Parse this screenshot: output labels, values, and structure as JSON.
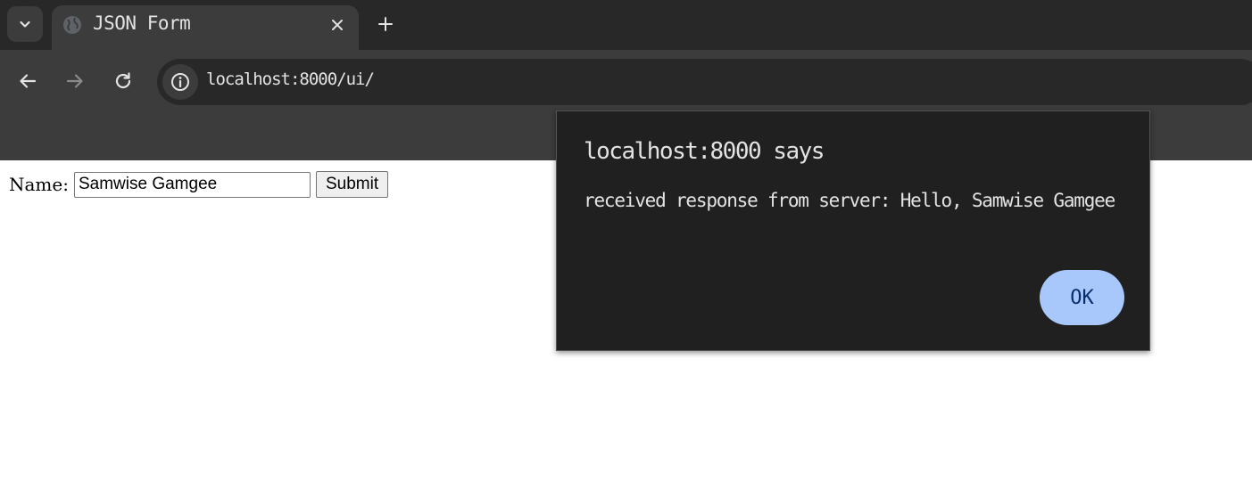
{
  "browser": {
    "tab": {
      "title": "JSON Form",
      "close_icon": "close-icon",
      "favicon_icon": "globe-icon"
    },
    "new_tab_icon": "plus-icon",
    "tab_search_icon": "chevron-down-icon",
    "nav": {
      "back_icon": "arrow-left-icon",
      "forward_icon": "arrow-right-icon",
      "reload_icon": "reload-icon"
    },
    "omnibox": {
      "url": "localhost:8000/ui/",
      "info_icon": "info-icon"
    }
  },
  "page": {
    "form": {
      "name_label": "Name:",
      "name_value": "Samwise Gamgee",
      "submit_label": "Submit"
    }
  },
  "dialog": {
    "title": "localhost:8000 says",
    "message": "received response from server: Hello, Samwise Gamgee",
    "ok_label": "OK"
  },
  "colors": {
    "tabstrip_bg": "#282828",
    "toolbar_bg": "#3c3c3c",
    "dialog_bg": "#202020",
    "ok_button_bg": "#a8c7fa",
    "ok_button_text": "#062e6f"
  }
}
